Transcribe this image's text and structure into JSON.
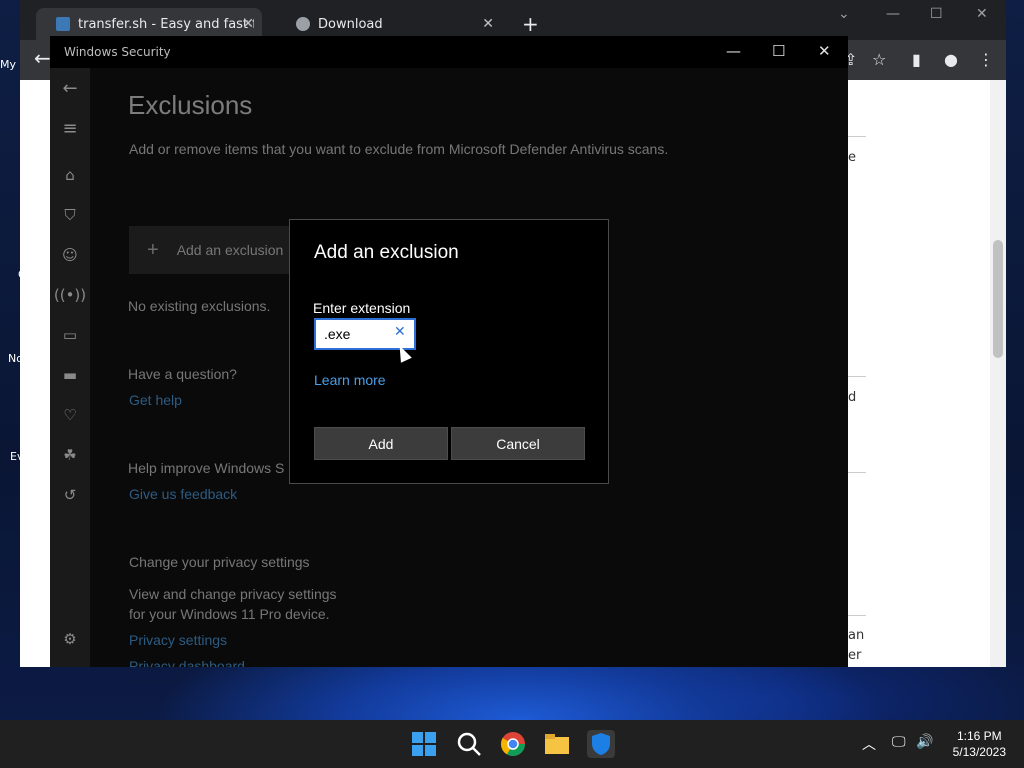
{
  "desktop": {
    "icon_labels": [
      "My",
      "C",
      "No",
      "Ev"
    ]
  },
  "chrome": {
    "tabs": [
      {
        "title": "transfer.sh - Easy and fast file sha",
        "active": true
      },
      {
        "title": "Download",
        "active": false
      }
    ],
    "page_fragments": [
      "e",
      "d",
      "an",
      "er"
    ]
  },
  "window": {
    "title": "Windows Security"
  },
  "exclusions": {
    "heading": "Exclusions",
    "description": "Add or remove items that you want to exclude from Microsoft Defender Antivirus scans.",
    "add_button_label": "Add an exclusion",
    "no_exclusions": "No existing exclusions.",
    "question_heading": "Have a question?",
    "get_help": "Get help",
    "improve_heading": "Help improve Windows S",
    "feedback_link": "Give us feedback",
    "privacy_heading": "Change your privacy settings",
    "privacy_desc_1": "View and change privacy settings",
    "privacy_desc_2": "for your Windows 11 Pro device.",
    "privacy_link": "Privacy settings",
    "privacy_dashboard": "Privacy dashboard"
  },
  "dialog": {
    "title": "Add an exclusion",
    "field_label": "Enter extension",
    "field_value": ".exe",
    "learn_more": "Learn more",
    "add_label": "Add",
    "cancel_label": "Cancel"
  },
  "taskbar": {
    "time": "1:16 PM",
    "date": "5/13/2023"
  },
  "colors": {
    "accent": "#2d6fd6",
    "link": "#4a9fe6"
  }
}
